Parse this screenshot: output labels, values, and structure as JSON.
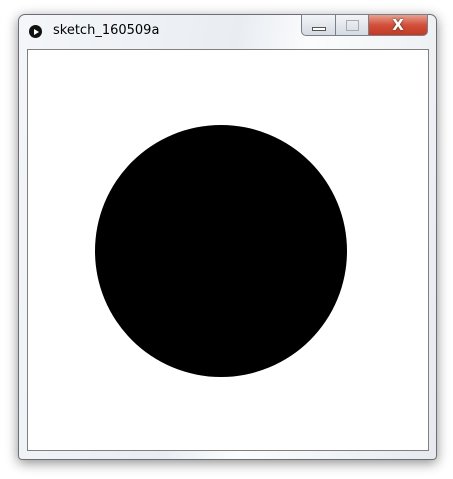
{
  "window": {
    "title": "sketch_160509a",
    "close_glyph": "X"
  },
  "sketch": {
    "circle_color": "#000000",
    "background": "#ffffff"
  }
}
